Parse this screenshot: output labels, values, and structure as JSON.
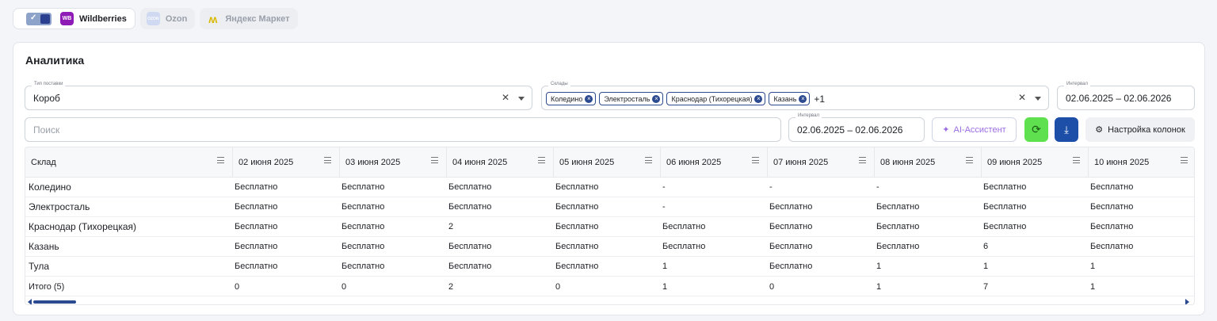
{
  "marketplaces": [
    {
      "label": "Wildberries",
      "logo": "WB",
      "active": true
    },
    {
      "label": "Ozon",
      "logo": "OZON",
      "active": false
    },
    {
      "label": "Яндекс Маркет",
      "logo": "Я",
      "active": false
    }
  ],
  "page": {
    "title": "Аналитика"
  },
  "filters": {
    "supply_type": {
      "label": "Тип поставки",
      "value": "Короб"
    },
    "warehouses": {
      "label": "Склады",
      "chips": [
        "Коледино",
        "Электросталь",
        "Краснодар (Тихорецкая)",
        "Казань"
      ],
      "more": "+1"
    },
    "interval_top": {
      "label": "Интервал",
      "value": "02.06.2025 – 02.06.2026"
    },
    "interval": {
      "label": "Интервал",
      "value": "02.06.2025 – 02.06.2026"
    },
    "search_placeholder": "Поиск"
  },
  "toolbar": {
    "ai_label": "AI-Ассистент",
    "columns_label": "Настройка колонок"
  },
  "table": {
    "columns": [
      "Склад",
      "02 июня 2025",
      "03 июня 2025",
      "04 июня 2025",
      "05 июня 2025",
      "06 июня 2025",
      "07 июня 2025",
      "08 июня 2025",
      "09 июня 2025",
      "10 июня 2025"
    ],
    "rows": [
      [
        "Коледино",
        "Бесплатно",
        "Бесплатно",
        "Бесплатно",
        "Бесплатно",
        "-",
        "-",
        "-",
        "Бесплатно",
        "Бесплатно"
      ],
      [
        "Электросталь",
        "Бесплатно",
        "Бесплатно",
        "Бесплатно",
        "Бесплатно",
        "-",
        "Бесплатно",
        "Бесплатно",
        "Бесплатно",
        "Бесплатно"
      ],
      [
        "Краснодар (Тихорецкая)",
        "Бесплатно",
        "Бесплатно",
        "2",
        "Бесплатно",
        "Бесплатно",
        "Бесплатно",
        "Бесплатно",
        "Бесплатно",
        "Бесплатно"
      ],
      [
        "Казань",
        "Бесплатно",
        "Бесплатно",
        "Бесплатно",
        "Бесплатно",
        "Бесплатно",
        "Бесплатно",
        "Бесплатно",
        "6",
        "Бесплатно"
      ],
      [
        "Тула",
        "Бесплатно",
        "Бесплатно",
        "Бесплатно",
        "Бесплатно",
        "1",
        "Бесплатно",
        "1",
        "1",
        "1"
      ]
    ],
    "total": [
      "Итого (5)",
      "0",
      "0",
      "2",
      "0",
      "1",
      "0",
      "1",
      "7",
      "1"
    ]
  },
  "colors": {
    "accent": "#2c4a8f",
    "refresh": "#5ee04f",
    "download": "#1e4fa8",
    "ai": "#9b6de0"
  }
}
